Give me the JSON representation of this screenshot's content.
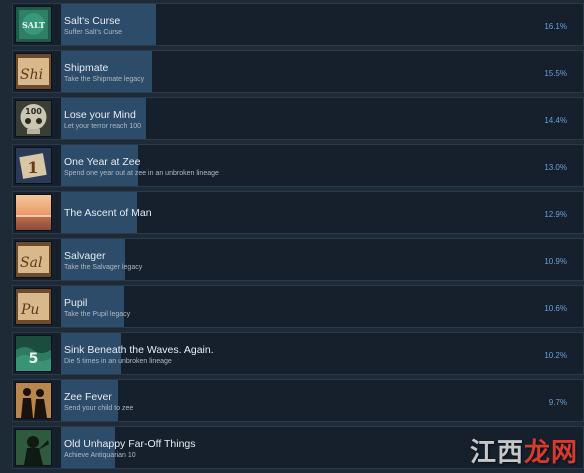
{
  "achievements": [
    {
      "name": "Salt's Curse",
      "desc": "Suffer Salt's Curse",
      "pct": "16.1%",
      "pct_value": 16.1,
      "icon": "salt-icon"
    },
    {
      "name": "Shipmate",
      "desc": "Take the Shipmate legacy",
      "pct": "15.5%",
      "pct_value": 15.5,
      "icon": "shipmate-scroll-icon"
    },
    {
      "name": "Lose your Mind",
      "desc": "Let your terror reach 100",
      "pct": "14.4%",
      "pct_value": 14.4,
      "icon": "skull-100-icon"
    },
    {
      "name": "One Year at Zee",
      "desc": "Spend one year out at zee in an unbroken lineage",
      "pct": "13.0%",
      "pct_value": 13.0,
      "icon": "calendar-one-icon"
    },
    {
      "name": "The Ascent of Man",
      "desc": "",
      "pct": "12.9%",
      "pct_value": 12.9,
      "icon": "sunset-icon"
    },
    {
      "name": "Salvager",
      "desc": "Take the Salvager legacy",
      "pct": "10.9%",
      "pct_value": 10.9,
      "icon": "salvager-scroll-icon"
    },
    {
      "name": "Pupil",
      "desc": "Take the Pupil legacy",
      "pct": "10.6%",
      "pct_value": 10.6,
      "icon": "pupil-scroll-icon"
    },
    {
      "name": "Sink Beneath the Waves. Again.",
      "desc": "Die 5 times in an unbroken lineage",
      "pct": "10.2%",
      "pct_value": 10.2,
      "icon": "waves-five-icon"
    },
    {
      "name": "Zee Fever",
      "desc": "Send your child to zee",
      "pct": "9.7%",
      "pct_value": 9.7,
      "icon": "couple-silhouette-icon"
    },
    {
      "name": "Old Unhappy Far-Off Things",
      "desc": "Achieve Antiquarian 10",
      "pct": "",
      "pct_value": null,
      "icon": "antiquarian-icon"
    }
  ],
  "icon_texts": {
    "salt": "SALT",
    "shipmate": "Shi",
    "skull": "100",
    "calendar": "1",
    "salvager": "Sal",
    "pupil": "Pu",
    "waves": "5"
  },
  "watermark": {
    "part1": "江西",
    "part2": "龙网"
  }
}
